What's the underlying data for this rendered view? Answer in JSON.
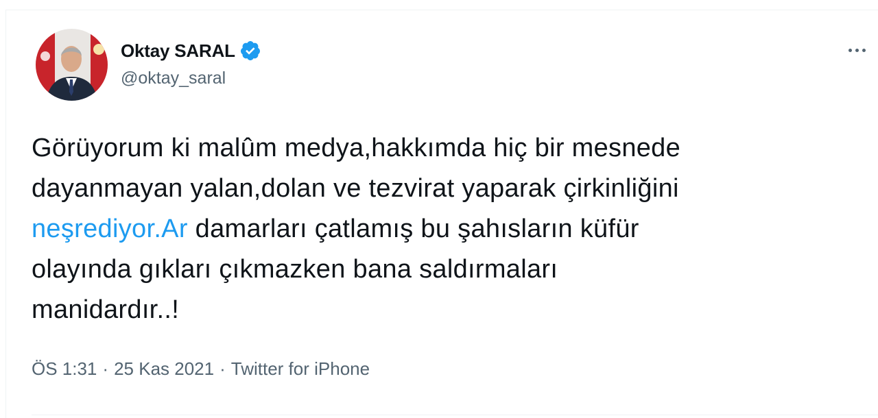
{
  "tweet": {
    "author": {
      "name": "Oktay SARAL",
      "handle": "@oktay_saral",
      "verified": true,
      "avatar_icon": "person-portrait-avatar"
    },
    "more_icon": "more-horizontal-icon",
    "body_lines": [
      "Görüyorum ki malûm medya,hakkımda hiç bir mesnede",
      "dayanmayan yalan,dolan ve tezvirat yaparak çirkinliğini"
    ],
    "link_text": "neşrediyor.Ar",
    "line3_rest": " damarları çatlamış bu şahısların küfür",
    "body_lines_after": [
      "olayında gıkları çıkmazken bana saldırmaları",
      "manidardır..!"
    ],
    "meta": {
      "time": "ÖS 1:31",
      "separator": "·",
      "date": "25 Kas 2021",
      "source": "Twitter for iPhone"
    }
  },
  "colors": {
    "text": "#0f1419",
    "secondary": "#536471",
    "link": "#1d9bf0",
    "verified": "#1d9bf0",
    "border": "#eff3f4"
  }
}
